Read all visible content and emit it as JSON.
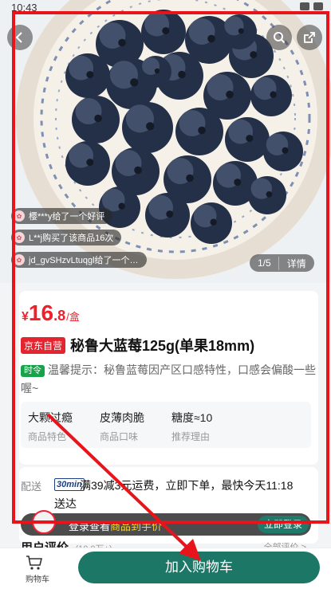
{
  "status": {
    "time": "10:43"
  },
  "hero": {
    "feed": [
      "樱***y给了一个好评",
      "L**j购买了该商品16次",
      "jd_gvSHzvLtuqgl给了一个…"
    ],
    "pager_index": "1/5",
    "pager_detail": "详情"
  },
  "product": {
    "currency": "¥",
    "price_int": "16",
    "price_dec": ".8",
    "price_unit": "/盒",
    "self_tag": "京东自营",
    "title": "秘鲁大蓝莓125g(单果18mm)",
    "season_tag": "时令",
    "tip": "温馨提示：秘鲁蓝莓因产区口感特性，口感会偏酸一些喔~",
    "attributes": [
      {
        "value": "大颗过瘾",
        "key": "商品特色"
      },
      {
        "value": "皮薄肉脆",
        "key": "商品口味"
      },
      {
        "value": "糖度≈10",
        "key": "推荐理由"
      }
    ]
  },
  "shipping": {
    "label": "配送",
    "logo": "30min",
    "text": "满39减3元运费，立即下单，最快今天11:18送达"
  },
  "login_bar": {
    "text_a": "登录查看",
    "text_b": "商品到手价",
    "action": "立即登录"
  },
  "reviews": {
    "title": "用户评价",
    "count": "(10.0万+)",
    "all_label": "全部评价 >"
  },
  "bottom": {
    "cart_label": "购物车",
    "add_to_cart": "加入购物车"
  },
  "colors": {
    "price_red": "#f0202b",
    "brand_green": "#1c7766",
    "annotation_red": "#e8141c"
  }
}
